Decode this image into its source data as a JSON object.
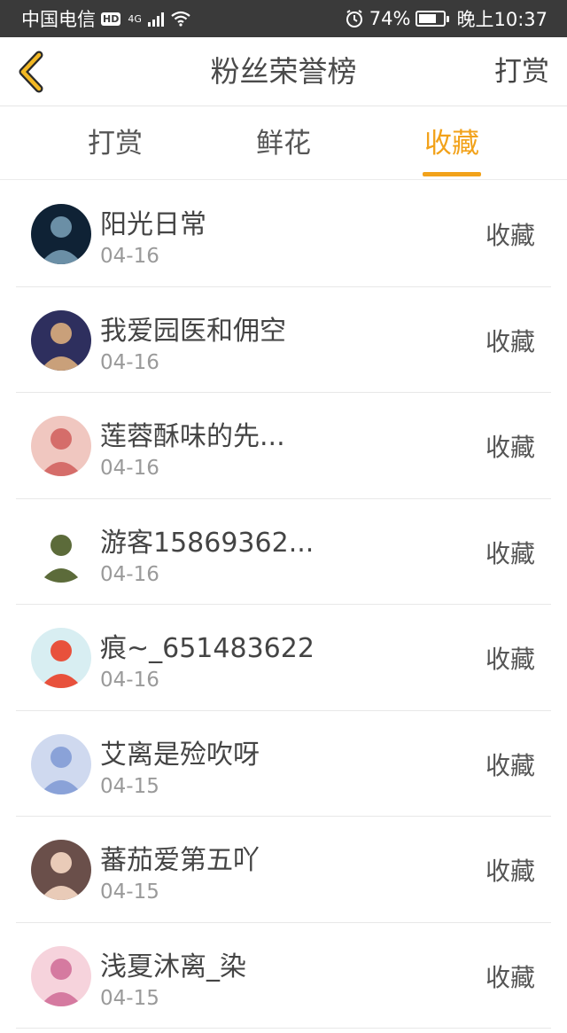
{
  "status_bar": {
    "carrier": "中国电信",
    "hd": "HD",
    "network": "4G",
    "battery_text": "74%",
    "battery_level": 0.74,
    "time": "晚上10:37"
  },
  "nav": {
    "title": "粉丝荣誉榜",
    "right_action": "打赏"
  },
  "tabs": [
    {
      "label": "打赏",
      "active": false
    },
    {
      "label": "鲜花",
      "active": false
    },
    {
      "label": "收藏",
      "active": true
    }
  ],
  "colors": {
    "accent": "#f2a21a",
    "status_bar_bg": "#3a3a3a"
  },
  "list": {
    "items": [
      {
        "name": "阳光日常",
        "date": "04-16",
        "action": "收藏",
        "avatar_colors": [
          "#0f2235",
          "#6b8fa6"
        ]
      },
      {
        "name": "我爱园医和佣空",
        "date": "04-16",
        "action": "收藏",
        "avatar_colors": [
          "#2e2f5e",
          "#c9a07a"
        ]
      },
      {
        "name": "莲蓉酥味的先...",
        "date": "04-16",
        "action": "收藏",
        "avatar_colors": [
          "#f0c7c0",
          "#d56d6a"
        ]
      },
      {
        "name": "游客15869362...",
        "date": "04-16",
        "action": "收藏",
        "avatar_colors": [
          "#ffffff",
          "#5c6b3a"
        ]
      },
      {
        "name": "痕~_651483622",
        "date": "04-16",
        "action": "收藏",
        "avatar_colors": [
          "#d8eef2",
          "#e8513c"
        ]
      },
      {
        "name": "艾离是殓吹呀",
        "date": "04-15",
        "action": "收藏",
        "avatar_colors": [
          "#cfd9ef",
          "#8aa2d8"
        ]
      },
      {
        "name": "蕃茄爱第五吖",
        "date": "04-15",
        "action": "收藏",
        "avatar_colors": [
          "#6a4f4a",
          "#e9cbb8"
        ]
      },
      {
        "name": "浅夏沐离_染",
        "date": "04-15",
        "action": "收藏",
        "avatar_colors": [
          "#f6d3dc",
          "#d57aa0"
        ]
      }
    ]
  }
}
